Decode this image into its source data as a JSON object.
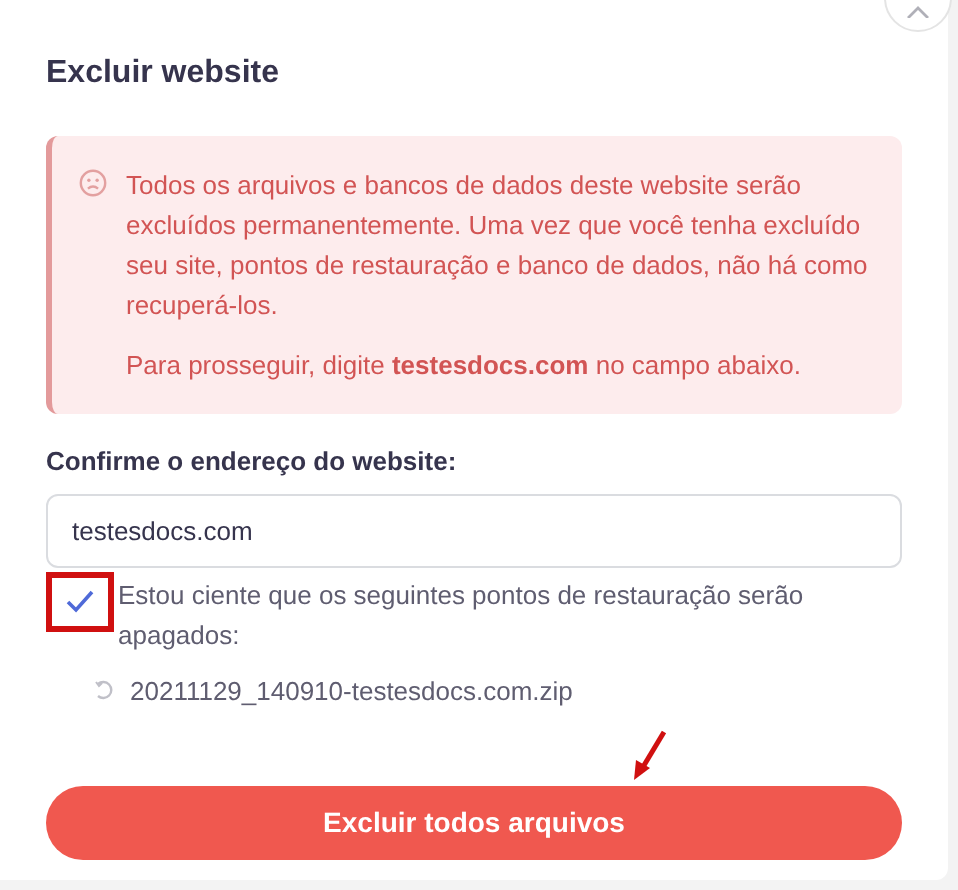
{
  "dialog": {
    "title": "Excluir website"
  },
  "alert": {
    "paragraphs": [
      "Todos os arquivos e bancos de dados deste website serão excluídos permanentemente. Uma vez que você tenha excluído seu site, pontos de restauração e banco de dados, não há como recuperá-los.",
      "Para prosseguir, digite **testesdocs.com** no campo abaixo."
    ]
  },
  "address_field": {
    "label": "Confirme o endereço do website:",
    "value": "testesdocs.com"
  },
  "confirm_checkbox": {
    "label": "Estou ciente que os seguintes pontos de restauração serão apagados:",
    "checked": true
  },
  "restore_points": [
    "20211129_140910-testesdocs.com.zip"
  ],
  "delete_button": {
    "label": "Excluir todos arquivos"
  }
}
